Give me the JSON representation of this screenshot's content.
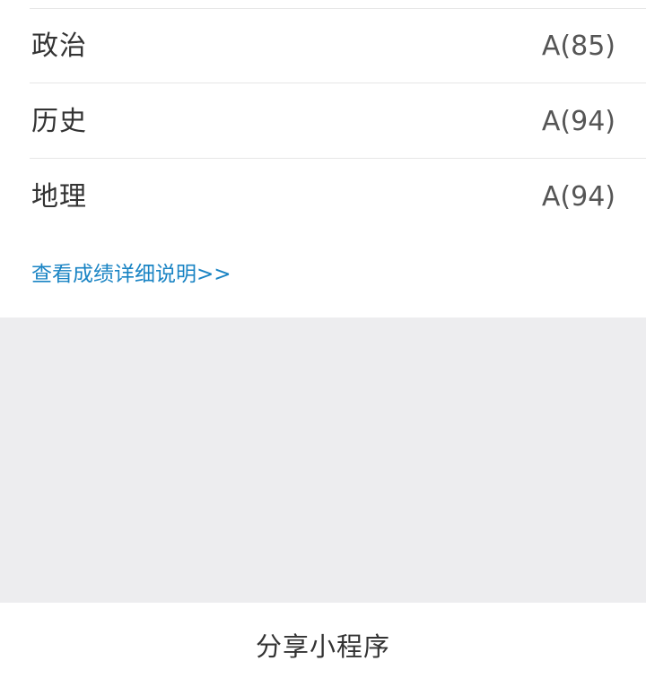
{
  "scores": [
    {
      "subject": "政治",
      "score": "A(85)"
    },
    {
      "subject": "历史",
      "score": "A(94)"
    },
    {
      "subject": "地理",
      "score": "A(94)"
    }
  ],
  "detail_link": "查看成绩详细说明>>",
  "share_button": "分享小程序",
  "colors": {
    "link": "#1a84c4",
    "text": "#333333",
    "background_gray": "#ededef",
    "divider": "#e6e6e6"
  }
}
